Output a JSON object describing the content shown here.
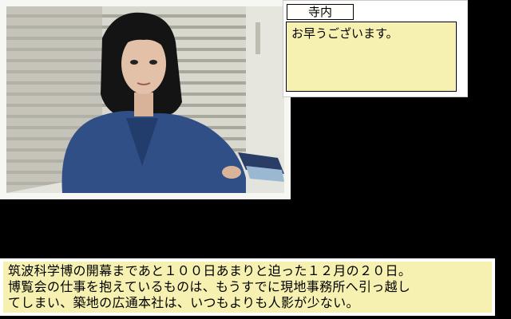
{
  "speaker": {
    "name": "寺内",
    "dialogue": "お早うございます。"
  },
  "narration": {
    "lines": [
      "筑波科学博の開幕まであと１００日あまりと迫った１２月の２０日。",
      "博覧会の仕事を抱えているものは、もうすでに現地事務所へ引っ越し",
      "てしまい、築地の広通本社は、いつもよりも人影が少ない。"
    ]
  },
  "colors": {
    "background": "#000000",
    "text_box": "#f6f1b0",
    "frame": "#ffffff",
    "outfit": "#2f4f86"
  }
}
